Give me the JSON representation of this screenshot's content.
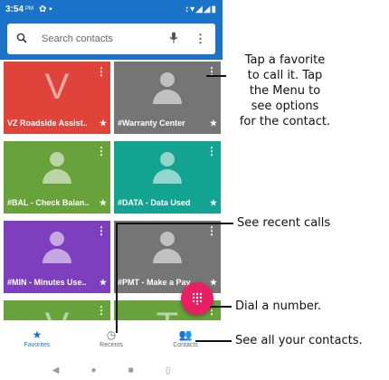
{
  "status_bar": {
    "time": "3:54",
    "ampm": "PM",
    "left_icons": "✿ ▪",
    "right_icons": "↕▾◢◢▮"
  },
  "search": {
    "placeholder": "Search contacts"
  },
  "favorites": [
    {
      "name": "VZ Roadside Assist..",
      "color": "#e0433a",
      "avatar": "letter",
      "letter": "V"
    },
    {
      "name": "#Warranty Center",
      "color": "#757575",
      "avatar": "person"
    },
    {
      "name": "#BAL - Check Balan..",
      "color": "#67a33a",
      "avatar": "person"
    },
    {
      "name": "#DATA - Data Used",
      "color": "#13a391",
      "avatar": "person"
    },
    {
      "name": "#MIN - Minutes Use..",
      "color": "#7e3fbf",
      "avatar": "person"
    },
    {
      "name": "#PMT - Make a Pay..",
      "color": "#757575",
      "avatar": "person"
    },
    {
      "name": "",
      "color": "#67a33a",
      "avatar": "letter",
      "letter": "V"
    },
    {
      "name": "",
      "color": "#67a33a",
      "avatar": "letter",
      "letter": "T"
    }
  ],
  "star": "★",
  "menu_glyph": "⋮",
  "fab_icon": "dialpad-icon",
  "bottom_nav": [
    {
      "label": "Favorites",
      "icon": "star-icon",
      "glyph": "★",
      "active": true
    },
    {
      "label": "Recents",
      "icon": "clock-icon",
      "glyph": "◷",
      "active": false
    },
    {
      "label": "Contacts",
      "icon": "people-icon",
      "glyph": "👥",
      "active": false
    }
  ],
  "system_nav": {
    "back": "◀",
    "home": "●",
    "recents": "■",
    "extra": "▯"
  },
  "callouts": {
    "favorite": [
      "Tap a favorite",
      "to call it. Tap",
      "the Menu to",
      "see options",
      "for the contact."
    ],
    "recent": "See recent calls",
    "dial": "Dial a number.",
    "contacts": "See all your contacts."
  },
  "colors": {
    "header_blue": "#1a73c8",
    "fab_pink": "#e91e63"
  }
}
